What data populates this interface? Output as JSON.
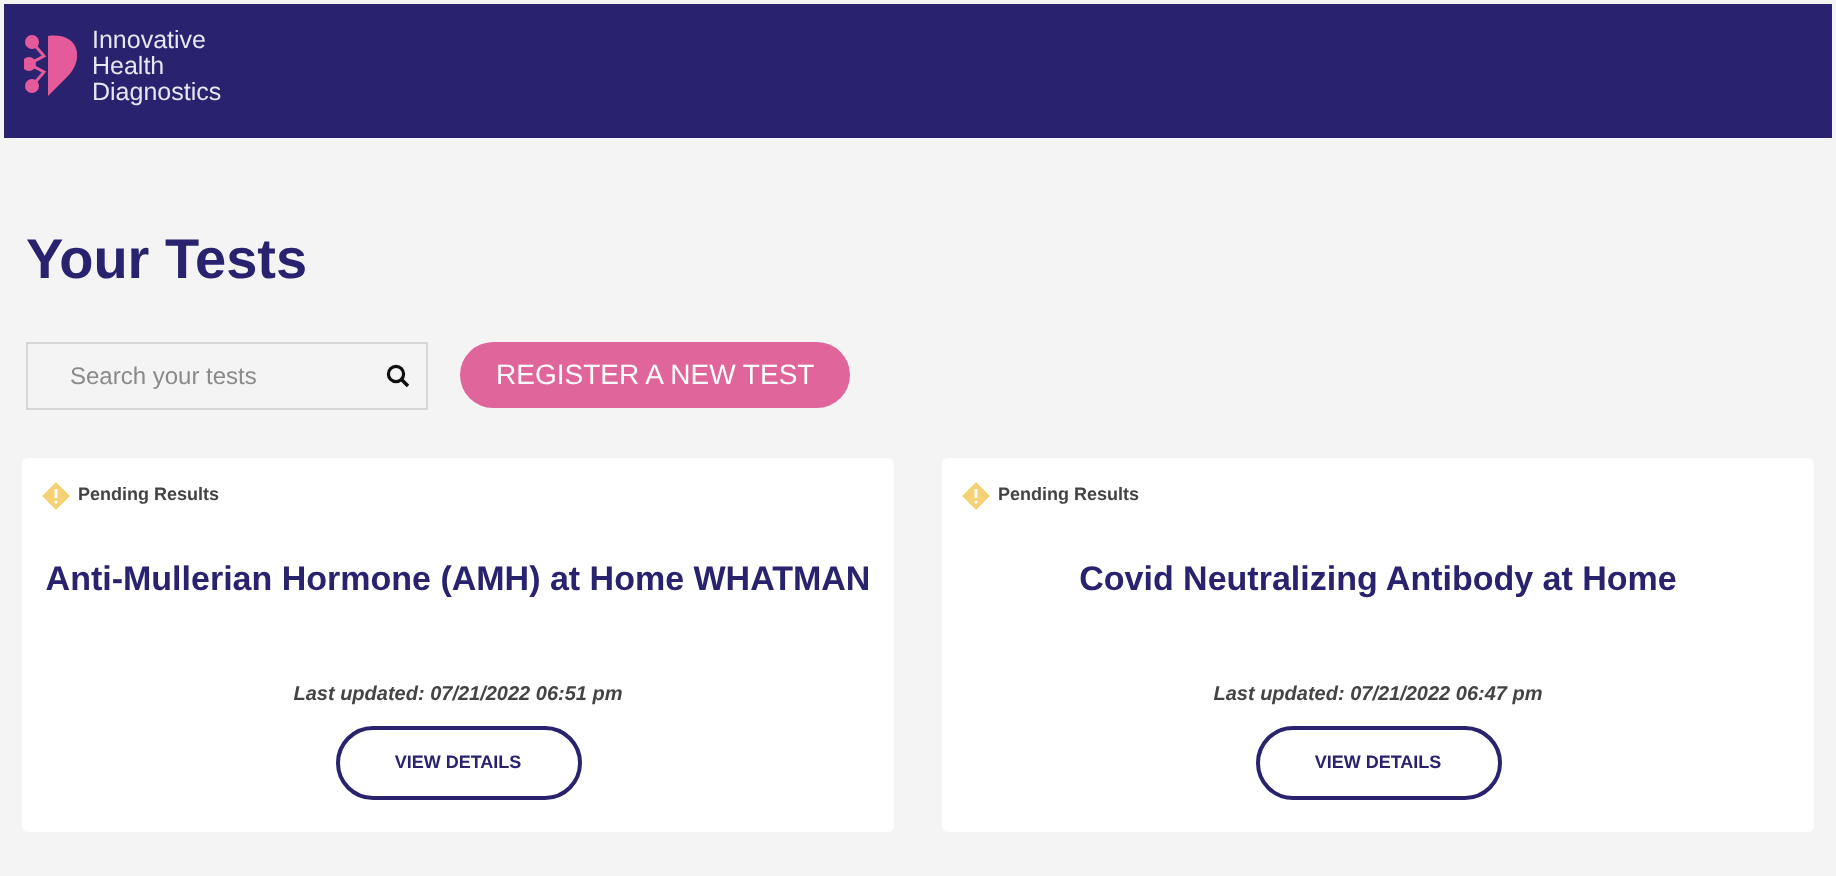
{
  "header": {
    "brand_lines": [
      "Innovative",
      "Health",
      "Diagnostics"
    ]
  },
  "page_title": "Your Tests",
  "search": {
    "placeholder": "Search your tests"
  },
  "register_button": "REGISTER A NEW TEST",
  "tests": [
    {
      "status": "Pending Results",
      "name": "Anti-Mullerian Hormone (AMH) at Home WHATMAN",
      "last_updated": "Last updated: 07/21/2022 06:51 pm",
      "button": "VIEW DETAILS"
    },
    {
      "status": "Pending Results",
      "name": "Covid Neutralizing Antibody at Home",
      "last_updated": "Last updated: 07/21/2022 06:47 pm",
      "button": "VIEW DETAILS"
    }
  ]
}
